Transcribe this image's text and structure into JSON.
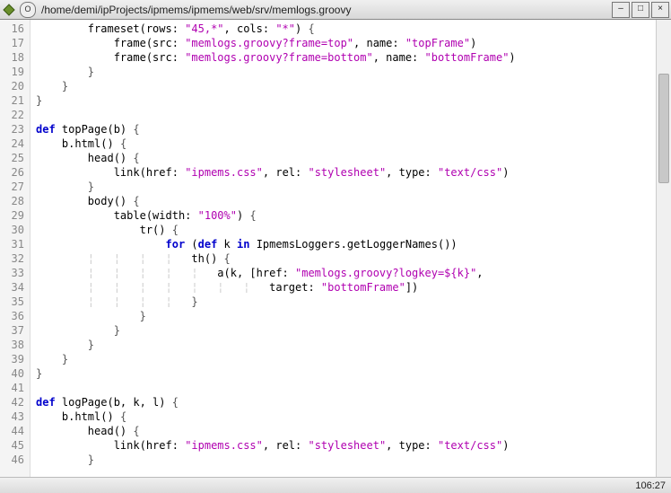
{
  "window": {
    "title": "/home/demi/ipProjects/ipmems/ipmems/web/srv/memlogs.groovy",
    "sticky_label": "O",
    "min_label": "–",
    "max_label": "□",
    "close_label": "×"
  },
  "status": {
    "position": "106:27"
  },
  "code": {
    "first_line": 16,
    "lines": [
      {
        "tokens": [
          {
            "c": "ws",
            "t": "        "
          },
          {
            "c": "id",
            "t": "frameset(rows: "
          },
          {
            "c": "str",
            "t": "\"45,*\""
          },
          {
            "c": "id",
            "t": ", cols: "
          },
          {
            "c": "str",
            "t": "\"*\""
          },
          {
            "c": "id",
            "t": ") "
          },
          {
            "c": "brace",
            "t": "{"
          }
        ]
      },
      {
        "tokens": [
          {
            "c": "ws",
            "t": "            "
          },
          {
            "c": "id",
            "t": "frame(src: "
          },
          {
            "c": "str",
            "t": "\"memlogs.groovy?frame=top\""
          },
          {
            "c": "id",
            "t": ", name: "
          },
          {
            "c": "str",
            "t": "\"topFrame\""
          },
          {
            "c": "id",
            "t": ")"
          }
        ]
      },
      {
        "tokens": [
          {
            "c": "ws",
            "t": "            "
          },
          {
            "c": "id",
            "t": "frame(src: "
          },
          {
            "c": "str",
            "t": "\"memlogs.groovy?frame=bottom\""
          },
          {
            "c": "id",
            "t": ", name: "
          },
          {
            "c": "str",
            "t": "\"bottomFrame\""
          },
          {
            "c": "id",
            "t": ")"
          }
        ]
      },
      {
        "tokens": [
          {
            "c": "ws",
            "t": "        "
          },
          {
            "c": "brace",
            "t": "}"
          }
        ]
      },
      {
        "tokens": [
          {
            "c": "ws",
            "t": "    "
          },
          {
            "c": "brace",
            "t": "}"
          }
        ]
      },
      {
        "tokens": [
          {
            "c": "brace",
            "t": "}"
          }
        ]
      },
      {
        "tokens": []
      },
      {
        "tokens": [
          {
            "c": "kw",
            "t": "def"
          },
          {
            "c": "id",
            "t": " topPage(b) "
          },
          {
            "c": "brace",
            "t": "{"
          }
        ]
      },
      {
        "tokens": [
          {
            "c": "ws",
            "t": "    "
          },
          {
            "c": "id",
            "t": "b.html() "
          },
          {
            "c": "brace",
            "t": "{"
          }
        ]
      },
      {
        "tokens": [
          {
            "c": "ws",
            "t": "        "
          },
          {
            "c": "id",
            "t": "head() "
          },
          {
            "c": "brace",
            "t": "{"
          }
        ]
      },
      {
        "tokens": [
          {
            "c": "ws",
            "t": "            "
          },
          {
            "c": "id",
            "t": "link(href: "
          },
          {
            "c": "str",
            "t": "\"ipmems.css\""
          },
          {
            "c": "id",
            "t": ", rel: "
          },
          {
            "c": "str",
            "t": "\"stylesheet\""
          },
          {
            "c": "id",
            "t": ", type: "
          },
          {
            "c": "str",
            "t": "\"text/css\""
          },
          {
            "c": "id",
            "t": ")"
          }
        ]
      },
      {
        "tokens": [
          {
            "c": "ws",
            "t": "        "
          },
          {
            "c": "brace",
            "t": "}"
          }
        ]
      },
      {
        "tokens": [
          {
            "c": "ws",
            "t": "        "
          },
          {
            "c": "id",
            "t": "body() "
          },
          {
            "c": "brace",
            "t": "{"
          }
        ]
      },
      {
        "tokens": [
          {
            "c": "ws",
            "t": "            "
          },
          {
            "c": "id",
            "t": "table(width: "
          },
          {
            "c": "str",
            "t": "\"100%\""
          },
          {
            "c": "id",
            "t": ") "
          },
          {
            "c": "brace",
            "t": "{"
          }
        ]
      },
      {
        "tokens": [
          {
            "c": "ws",
            "t": "                "
          },
          {
            "c": "id",
            "t": "tr() "
          },
          {
            "c": "brace",
            "t": "{"
          }
        ]
      },
      {
        "tokens": [
          {
            "c": "ws",
            "t": "                    "
          },
          {
            "c": "kw",
            "t": "for"
          },
          {
            "c": "id",
            "t": " ("
          },
          {
            "c": "kw",
            "t": "def"
          },
          {
            "c": "id",
            "t": " k "
          },
          {
            "c": "kw",
            "t": "in"
          },
          {
            "c": "id",
            "t": " IpmemsLoggers.getLoggerNames())"
          }
        ]
      },
      {
        "tokens": [
          {
            "c": "ws",
            "t": "        ¦   ¦   ¦   ¦   "
          },
          {
            "c": "id",
            "t": "th() "
          },
          {
            "c": "brace",
            "t": "{"
          }
        ]
      },
      {
        "tokens": [
          {
            "c": "ws",
            "t": "        ¦   ¦   ¦   ¦   ¦   "
          },
          {
            "c": "id",
            "t": "a(k, [href: "
          },
          {
            "c": "str",
            "t": "\"memlogs.groovy?logkey=${k}\""
          },
          {
            "c": "id",
            "t": ","
          }
        ]
      },
      {
        "tokens": [
          {
            "c": "ws",
            "t": "        ¦   ¦   ¦   ¦   ¦   ¦   ¦   "
          },
          {
            "c": "id",
            "t": "target: "
          },
          {
            "c": "str",
            "t": "\"bottomFrame\""
          },
          {
            "c": "id",
            "t": "])"
          }
        ]
      },
      {
        "tokens": [
          {
            "c": "ws",
            "t": "        ¦   ¦   ¦   ¦   "
          },
          {
            "c": "brace",
            "t": "}"
          }
        ]
      },
      {
        "tokens": [
          {
            "c": "ws",
            "t": "                "
          },
          {
            "c": "brace",
            "t": "}"
          }
        ]
      },
      {
        "tokens": [
          {
            "c": "ws",
            "t": "            "
          },
          {
            "c": "brace",
            "t": "}"
          }
        ]
      },
      {
        "tokens": [
          {
            "c": "ws",
            "t": "        "
          },
          {
            "c": "brace",
            "t": "}"
          }
        ]
      },
      {
        "tokens": [
          {
            "c": "ws",
            "t": "    "
          },
          {
            "c": "brace",
            "t": "}"
          }
        ]
      },
      {
        "tokens": [
          {
            "c": "brace",
            "t": "}"
          }
        ]
      },
      {
        "tokens": []
      },
      {
        "tokens": [
          {
            "c": "kw",
            "t": "def"
          },
          {
            "c": "id",
            "t": " logPage(b, k, l) "
          },
          {
            "c": "brace",
            "t": "{"
          }
        ]
      },
      {
        "tokens": [
          {
            "c": "ws",
            "t": "    "
          },
          {
            "c": "id",
            "t": "b.html() "
          },
          {
            "c": "brace",
            "t": "{"
          }
        ]
      },
      {
        "tokens": [
          {
            "c": "ws",
            "t": "        "
          },
          {
            "c": "id",
            "t": "head() "
          },
          {
            "c": "brace",
            "t": "{"
          }
        ]
      },
      {
        "tokens": [
          {
            "c": "ws",
            "t": "            "
          },
          {
            "c": "id",
            "t": "link(href: "
          },
          {
            "c": "str",
            "t": "\"ipmems.css\""
          },
          {
            "c": "id",
            "t": ", rel: "
          },
          {
            "c": "str",
            "t": "\"stylesheet\""
          },
          {
            "c": "id",
            "t": ", type: "
          },
          {
            "c": "str",
            "t": "\"text/css\""
          },
          {
            "c": "id",
            "t": ")"
          }
        ]
      },
      {
        "tokens": [
          {
            "c": "ws",
            "t": "        "
          },
          {
            "c": "brace",
            "t": "}"
          }
        ]
      }
    ]
  }
}
